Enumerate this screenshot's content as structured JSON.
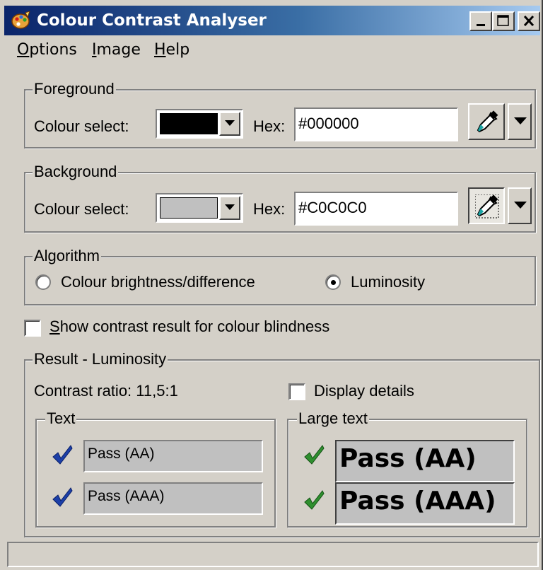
{
  "window": {
    "title": "Colour Contrast Analyser",
    "icon": "palette-icon"
  },
  "menu": [
    {
      "first": "O",
      "rest": "ptions"
    },
    {
      "first": "I",
      "rest": "mage"
    },
    {
      "first": "H",
      "rest": "elp"
    }
  ],
  "foreground": {
    "group_label": "Foreground",
    "colour_select_label": "Colour select:",
    "swatch_color": "#000000",
    "hex_label": "Hex:",
    "hex_value": "#000000"
  },
  "background": {
    "group_label": "Background",
    "colour_select_label": "Colour select:",
    "swatch_color": "#C0C0C0",
    "hex_label": "Hex:",
    "hex_value": "#C0C0C0"
  },
  "algorithm": {
    "group_label": "Algorithm",
    "options": [
      "Colour brightness/difference",
      "Luminosity"
    ],
    "selected": "Luminosity"
  },
  "colour_blindness": {
    "first": "S",
    "rest": "how contrast result for colour blindness",
    "checked": false
  },
  "result": {
    "group_label": "Result - Luminosity",
    "contrast_ratio": "Contrast ratio: 11,5:1",
    "display_details": "Display details",
    "display_details_checked": false,
    "text_group_label": "Text",
    "text_results": [
      "Pass (AA)",
      "Pass (AAA)"
    ],
    "large_group_label": "Large text",
    "large_results": [
      "Pass (AA)",
      "Pass (AAA)"
    ]
  },
  "colors": {
    "title_start": "#0a246a",
    "title_end": "#a6caf0",
    "face": "#d4d0c8",
    "result_bg": "#c0c0c0",
    "tick_blue": "#1c3fa8",
    "tick_green": "#2f8f2f"
  }
}
